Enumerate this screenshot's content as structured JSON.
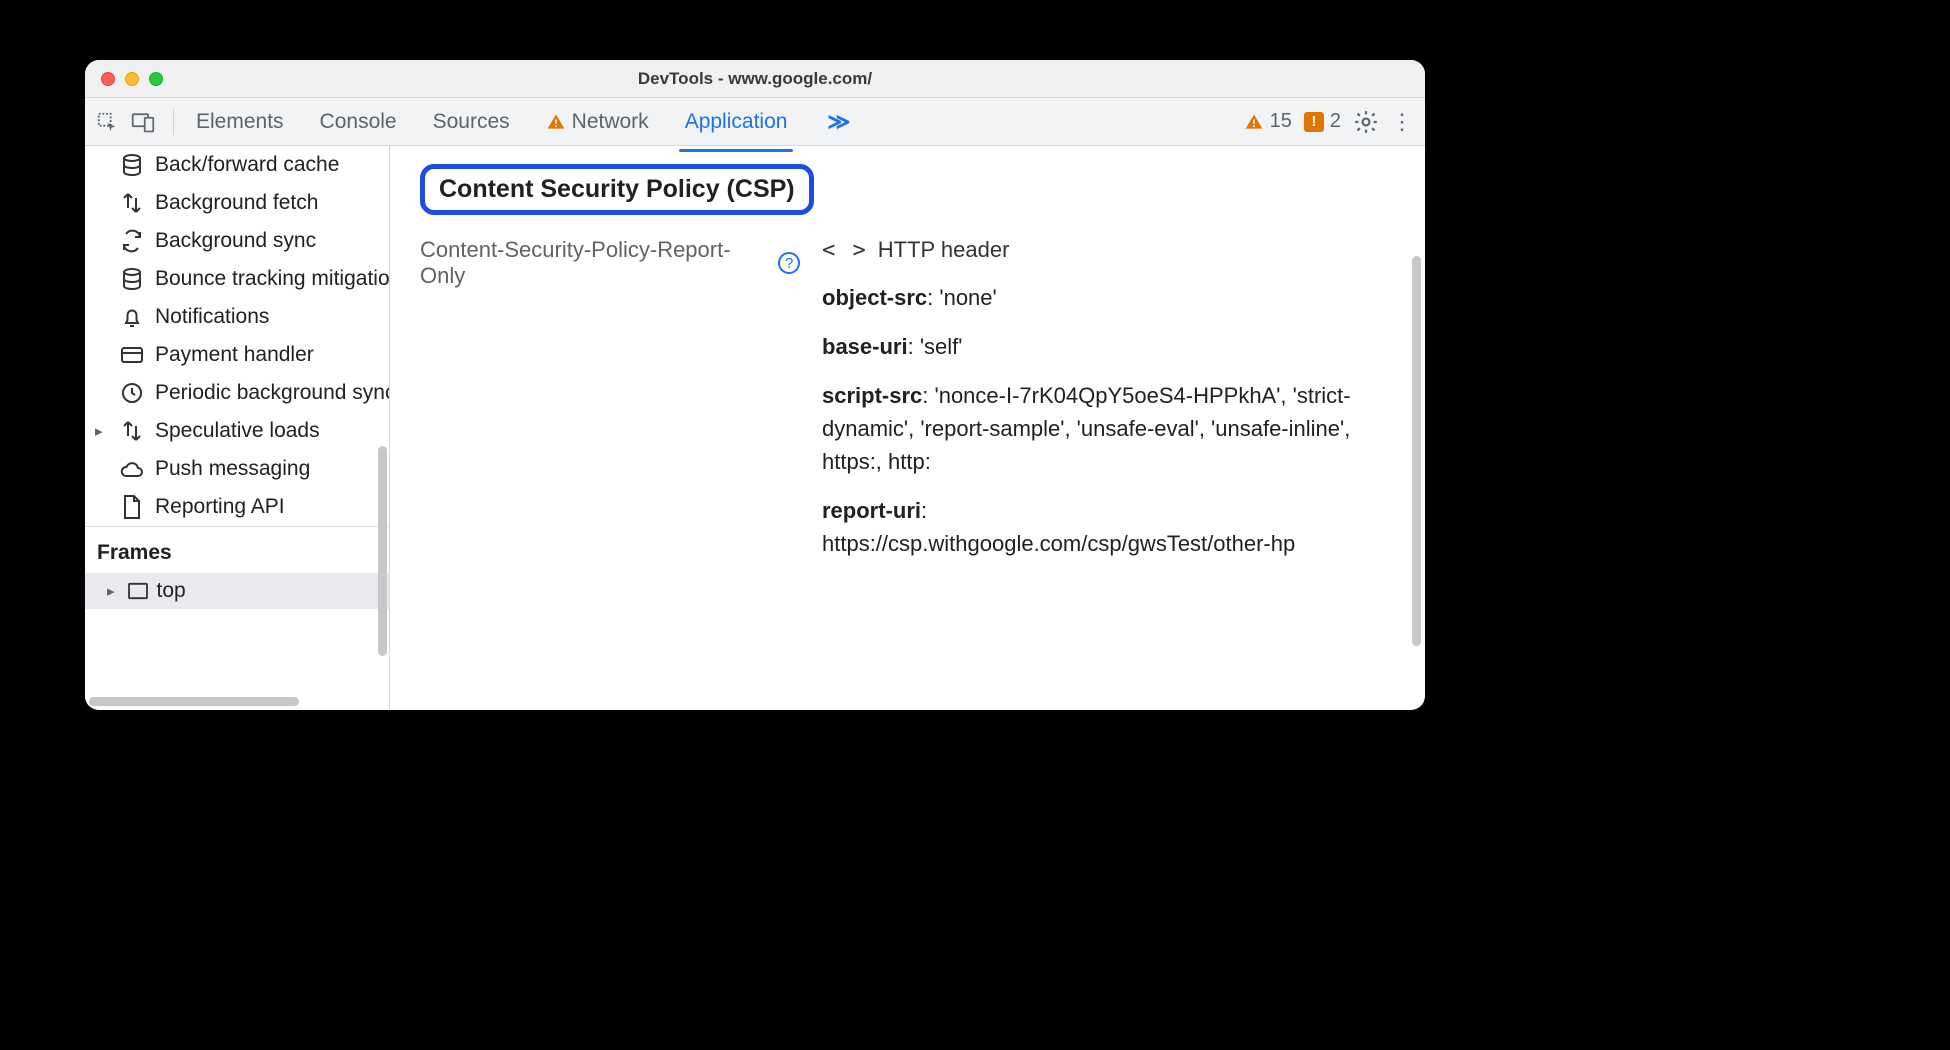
{
  "window": {
    "title": "DevTools - www.google.com/"
  },
  "tabs": {
    "items": [
      "Elements",
      "Console",
      "Sources",
      "Network",
      "Application"
    ],
    "active_index": 4,
    "network_has_warning": true,
    "more_glyph": "≫"
  },
  "toolbar_right": {
    "warn_count": "15",
    "issue_count": "2",
    "issue_badge_glyph": "!"
  },
  "sidebar": {
    "items": [
      {
        "icon": "database",
        "label": "Back/forward cache",
        "expandable": false
      },
      {
        "icon": "updown",
        "label": "Background fetch",
        "expandable": false
      },
      {
        "icon": "sync",
        "label": "Background sync",
        "expandable": false
      },
      {
        "icon": "database",
        "label": "Bounce tracking mitigation",
        "expandable": false
      },
      {
        "icon": "bell",
        "label": "Notifications",
        "expandable": false
      },
      {
        "icon": "card",
        "label": "Payment handler",
        "expandable": false
      },
      {
        "icon": "clock",
        "label": "Periodic background sync",
        "expandable": false
      },
      {
        "icon": "updown",
        "label": "Speculative loads",
        "expandable": true
      },
      {
        "icon": "cloud",
        "label": "Push messaging",
        "expandable": false
      },
      {
        "icon": "file",
        "label": "Reporting API",
        "expandable": false
      }
    ],
    "frames_section": "Frames",
    "frame_top": "top"
  },
  "csp": {
    "heading": "Content Security Policy (CSP)",
    "policy_name": "Content-Security-Policy-Report-Only",
    "source_label": "HTTP header",
    "directives": [
      {
        "name": "object-src",
        "value": "'none'"
      },
      {
        "name": "base-uri",
        "value": "'self'"
      },
      {
        "name": "script-src",
        "value": "'nonce-I-7rK04QpY5oeS4-HPPkhA', 'strict-dynamic', 'report-sample', 'unsafe-eval', 'unsafe-inline', https:, http:"
      },
      {
        "name": "report-uri",
        "value": "https://csp.withgoogle.com/csp/gwsTest/other-hp"
      }
    ]
  }
}
